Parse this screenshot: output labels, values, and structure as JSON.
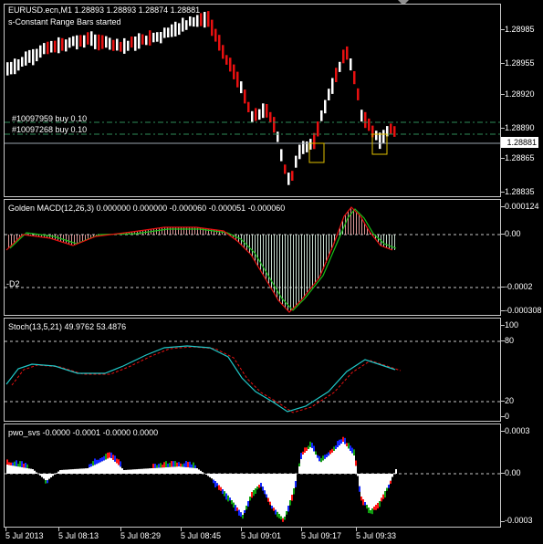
{
  "main": {
    "header": "EURUSD.ecn,M1  1.28893 1.28893 1.28874 1.28881",
    "status": "s-Constant Range Bars started",
    "orders": [
      "#10097959 buy 0.10",
      "#10097268 buy 0.10"
    ],
    "current_price": "1.28881",
    "price_ticks": [
      "1.28985",
      "1.28955",
      "1.28920",
      "1.28890",
      "1.28865",
      "1.28835"
    ]
  },
  "macd": {
    "header": "Golden MACD(12,26,3) 0.000000 0.000000 -0.000060 -0.000051 -0.000060",
    "level_label": "-D2",
    "ticks": [
      "0.000124",
      "0.00",
      "-0.0002",
      "-0.000308"
    ]
  },
  "stoch": {
    "header": "Stoch(13,5,21) 49.9762 53.4876",
    "ticks": [
      "100",
      "80",
      "20",
      "0"
    ]
  },
  "pwo": {
    "header": "pwo_svs -0.0000 -0.0001 -0.0000 0.0000",
    "ticks": [
      "0.0003",
      "0.00",
      "-0.0003"
    ]
  },
  "time_axis": [
    "5 Jul 2013",
    "5 Jul 08:13",
    "5 Jul 08:29",
    "5 Jul 08:45",
    "5 Jul 09:01",
    "5 Jul 09:17",
    "5 Jul 09:33"
  ],
  "colors": {
    "bull": "#ffffff",
    "bear": "#e81010",
    "macd_main": "#e81010",
    "macd_signal": "#18c018",
    "stoch_main": "#20c8c8",
    "stoch_signal": "#e81010",
    "pwo_blue": "#1428ff",
    "pwo_green": "#10a010",
    "pwo_red": "#ff1414",
    "level": "#c8c8c8",
    "order_line": "#2e8b57",
    "box": "#e0c000"
  }
}
